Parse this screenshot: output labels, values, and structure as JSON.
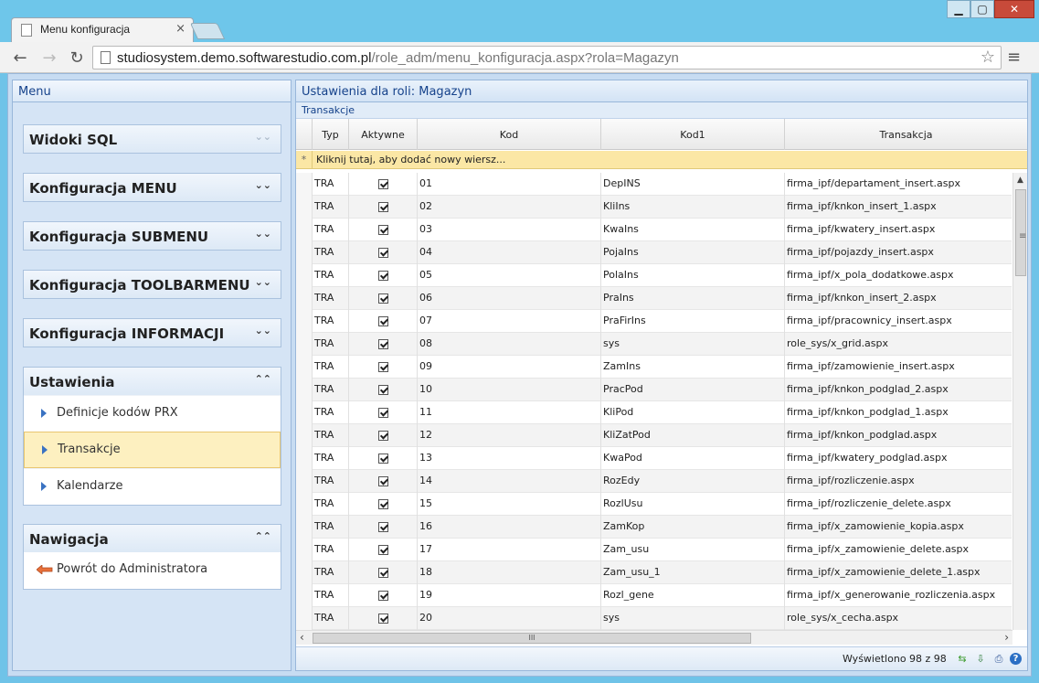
{
  "browser": {
    "tab_title": "Menu konfiguracja",
    "tab_close": "×",
    "url_host": "studiosystem.demo.softwarestudio.com.pl",
    "url_path": "/role_adm/menu_konfiguracja.aspx?rola=Magazyn",
    "back_icon": "←",
    "forward_icon": "→",
    "reload_icon": "↻",
    "star_icon": "☆",
    "menu_icon": "≡",
    "win_min": "▁",
    "win_max": "▢",
    "win_close": "✕"
  },
  "menu": {
    "header": "Menu",
    "groups": [
      {
        "title": "Widoki SQL",
        "chevron": "⌄⌄"
      },
      {
        "title": "Konfiguracja MENU",
        "chevron": "⌄⌄"
      },
      {
        "title": "Konfiguracja SUBMENU",
        "chevron": "⌄⌄"
      },
      {
        "title": "Konfiguracja TOOLBARMENU",
        "chevron": "⌄⌄"
      },
      {
        "title": "Konfiguracja INFORMACJI",
        "chevron": "⌄⌄"
      }
    ],
    "ustawienia": {
      "title": "Ustawienia",
      "chevron": "⌃⌃",
      "items": [
        "Definicje kodów PRX",
        "Transakcje",
        "Kalendarze"
      ],
      "selected": "Transakcje"
    },
    "nawigacja": {
      "title": "Nawigacja",
      "chevron": "⌃⌃",
      "items": [
        "Powrót do Administratora"
      ]
    }
  },
  "main": {
    "header": "Ustawienia dla roli: Magazyn",
    "grid_caption": "Transakcje",
    "add_row_marker": "*",
    "add_row_text": "Kliknij tutaj, aby dodać nowy wiersz...",
    "columns": [
      "Typ",
      "Aktywne",
      "Kod",
      "Kod1",
      "Transakcja"
    ],
    "rows": [
      {
        "typ": "TRA",
        "aktywne": true,
        "kod": "01",
        "kod1": "DepINS",
        "transakcja": "firma_ipf/departament_insert.aspx"
      },
      {
        "typ": "TRA",
        "aktywne": true,
        "kod": "02",
        "kod1": "KliIns",
        "transakcja": "firma_ipf/knkon_insert_1.aspx"
      },
      {
        "typ": "TRA",
        "aktywne": true,
        "kod": "03",
        "kod1": "KwaIns",
        "transakcja": "firma_ipf/kwatery_insert.aspx"
      },
      {
        "typ": "TRA",
        "aktywne": true,
        "kod": "04",
        "kod1": "PojaIns",
        "transakcja": "firma_ipf/pojazdy_insert.aspx"
      },
      {
        "typ": "TRA",
        "aktywne": true,
        "kod": "05",
        "kod1": "PolaIns",
        "transakcja": "firma_ipf/x_pola_dodatkowe.aspx"
      },
      {
        "typ": "TRA",
        "aktywne": true,
        "kod": "06",
        "kod1": "PraIns",
        "transakcja": "firma_ipf/knkon_insert_2.aspx"
      },
      {
        "typ": "TRA",
        "aktywne": true,
        "kod": "07",
        "kod1": "PraFirIns",
        "transakcja": "firma_ipf/pracownicy_insert.aspx"
      },
      {
        "typ": "TRA",
        "aktywne": true,
        "kod": "08",
        "kod1": "sys",
        "transakcja": "role_sys/x_grid.aspx"
      },
      {
        "typ": "TRA",
        "aktywne": true,
        "kod": "09",
        "kod1": "ZamIns",
        "transakcja": "firma_ipf/zamowienie_insert.aspx"
      },
      {
        "typ": "TRA",
        "aktywne": true,
        "kod": "10",
        "kod1": "PracPod",
        "transakcja": "firma_ipf/knkon_podglad_2.aspx"
      },
      {
        "typ": "TRA",
        "aktywne": true,
        "kod": "11",
        "kod1": "KliPod",
        "transakcja": "firma_ipf/knkon_podglad_1.aspx"
      },
      {
        "typ": "TRA",
        "aktywne": true,
        "kod": "12",
        "kod1": "KliZatPod",
        "transakcja": "firma_ipf/knkon_podglad.aspx"
      },
      {
        "typ": "TRA",
        "aktywne": true,
        "kod": "13",
        "kod1": "KwaPod",
        "transakcja": "firma_ipf/kwatery_podglad.aspx"
      },
      {
        "typ": "TRA",
        "aktywne": true,
        "kod": "14",
        "kod1": "RozEdy",
        "transakcja": "firma_ipf/rozliczenie.aspx"
      },
      {
        "typ": "TRA",
        "aktywne": true,
        "kod": "15",
        "kod1": "RozlUsu",
        "transakcja": "firma_ipf/rozliczenie_delete.aspx"
      },
      {
        "typ": "TRA",
        "aktywne": true,
        "kod": "16",
        "kod1": "ZamKop",
        "transakcja": "firma_ipf/x_zamowienie_kopia.aspx"
      },
      {
        "typ": "TRA",
        "aktywne": true,
        "kod": "17",
        "kod1": "Zam_usu",
        "transakcja": "firma_ipf/x_zamowienie_delete.aspx"
      },
      {
        "typ": "TRA",
        "aktywne": true,
        "kod": "18",
        "kod1": "Zam_usu_1",
        "transakcja": "firma_ipf/x_zamowienie_delete_1.aspx"
      },
      {
        "typ": "TRA",
        "aktywne": true,
        "kod": "19",
        "kod1": "Rozl_gene",
        "transakcja": "firma_ipf/x_generowanie_rozliczenia.aspx"
      },
      {
        "typ": "TRA",
        "aktywne": true,
        "kod": "20",
        "kod1": "sys",
        "transakcja": "role_sys/x_cecha.aspx"
      }
    ],
    "status": "Wyświetlono 98 z 98",
    "status_icons": {
      "refresh": "⇆",
      "export": "⇩",
      "print": "⎙",
      "help": "?"
    },
    "scroll_grip": "≡",
    "hscroll_grip": "III",
    "hscroll_left": "‹",
    "hscroll_right": "›",
    "vscroll_up": "▲"
  }
}
